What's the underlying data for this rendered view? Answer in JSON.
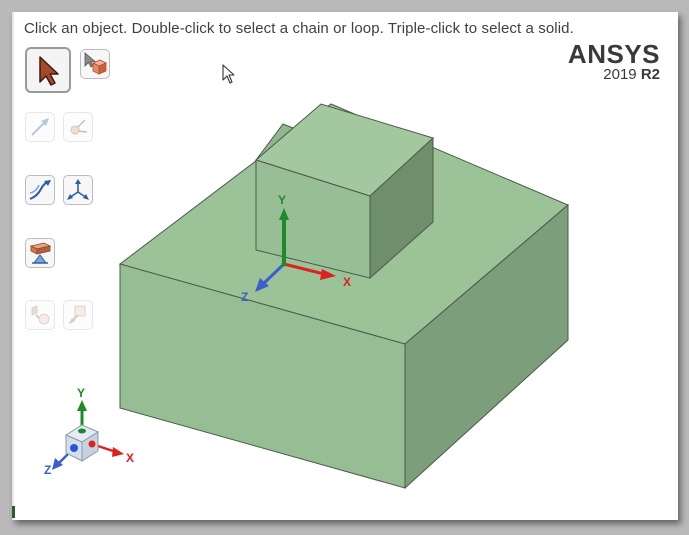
{
  "hint_text": "Click an object.  Double-click to select a chain or loop.  Triple-click to select a solid.",
  "logo": {
    "name": "ANSYS",
    "year": "2019",
    "release": "R2"
  },
  "toolbar": [
    {
      "name": "select-mode-button",
      "icon": "arrow-cursor-icon",
      "active": true,
      "enabled": true
    },
    {
      "name": "select-box-button",
      "icon": "box-select-icon",
      "active": false,
      "enabled": true
    },
    {
      "name": "pull-tool-button",
      "icon": "pull-arrow-icon",
      "active": false,
      "enabled": false
    },
    {
      "name": "move-tool-button",
      "icon": "move-icon",
      "active": false,
      "enabled": false
    },
    {
      "name": "blend-tool-button",
      "icon": "blend-icon",
      "active": false,
      "enabled": true
    },
    {
      "name": "axis-tool-button",
      "icon": "axis-move-icon",
      "active": false,
      "enabled": true
    },
    {
      "name": "fill-tool-button",
      "icon": "fill-icon",
      "active": false,
      "enabled": true
    },
    {
      "name": "combine-tool-button",
      "icon": "combine-icon",
      "active": false,
      "enabled": false
    },
    {
      "name": "split-tool-button",
      "icon": "split-icon",
      "active": false,
      "enabled": false
    }
  ],
  "model_triad": {
    "x": "X",
    "y": "Y",
    "z": "Z"
  },
  "corner_triad": {
    "x": "X",
    "y": "Y",
    "z": "Z"
  },
  "colors": {
    "solid_top": "#9dc39a",
    "solid_front": "#96bd93",
    "solid_right": "#7c9e79",
    "edge": "#4b5a4b",
    "axis_x": "#e02020",
    "axis_y": "#1f8a2a",
    "axis_z": "#3a5fd0"
  }
}
